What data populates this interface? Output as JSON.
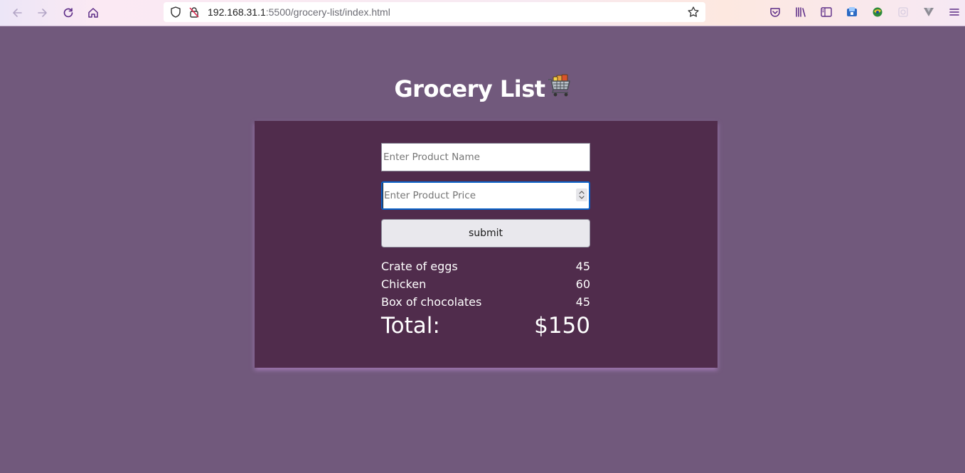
{
  "browser": {
    "url_host": "192.168.31.1",
    "url_rest": ":5500/grocery-list/index.html",
    "icons": [
      "back-icon",
      "forward-icon",
      "reload-icon",
      "home-icon",
      "shield-icon",
      "not-secure-icon",
      "bookmark-star-icon",
      "pocket-icon",
      "library-icon",
      "sidebar-icon",
      "extension-icon",
      "extension-icon",
      "extension-icon",
      "extension-icon",
      "menu-icon"
    ]
  },
  "page": {
    "title": "Grocery List",
    "title_emoji": "shopping-cart-icon",
    "name_placeholder": "Enter Product Name",
    "price_placeholder": "Enter Product Price",
    "submit_label": "submit"
  },
  "items": [
    {
      "name": "Crate of eggs",
      "price": "45"
    },
    {
      "name": "Chicken",
      "price": "60"
    },
    {
      "name": "Box of chocolates",
      "price": "45"
    }
  ],
  "total": {
    "label": "Total:",
    "value": "$150"
  },
  "colors": {
    "page_bg": "#71597c",
    "card_bg": "#502c4c",
    "focus_border": "#0a62c9"
  }
}
